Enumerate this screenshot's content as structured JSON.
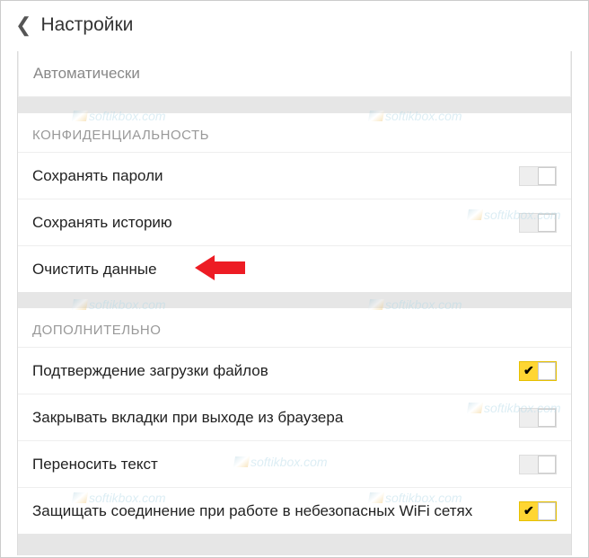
{
  "header": {
    "title": "Настройки"
  },
  "auto_section": {
    "label": "Автоматически"
  },
  "sections": [
    {
      "header": "КОНФИДЕНЦИАЛЬНОСТЬ",
      "items": [
        {
          "label": "Сохранять пароли",
          "toggle": true,
          "on": false
        },
        {
          "label": "Сохранять историю",
          "toggle": true,
          "on": false
        },
        {
          "label": "Очистить данные",
          "toggle": false
        }
      ]
    },
    {
      "header": "ДОПОЛНИТЕЛЬНО",
      "items": [
        {
          "label": "Подтверждение загрузки файлов",
          "toggle": true,
          "on": true
        },
        {
          "label": "Закрывать вкладки при выходе из браузера",
          "toggle": true,
          "on": false
        },
        {
          "label": "Переносить текст",
          "toggle": true,
          "on": false
        },
        {
          "label": "Защищать соединение при работе в небезопасных WiFi сетях",
          "toggle": true,
          "on": true
        }
      ]
    }
  ],
  "watermark": {
    "text": "softikbox.com"
  },
  "annotation": {
    "arrow_color": "#ed1c24"
  }
}
